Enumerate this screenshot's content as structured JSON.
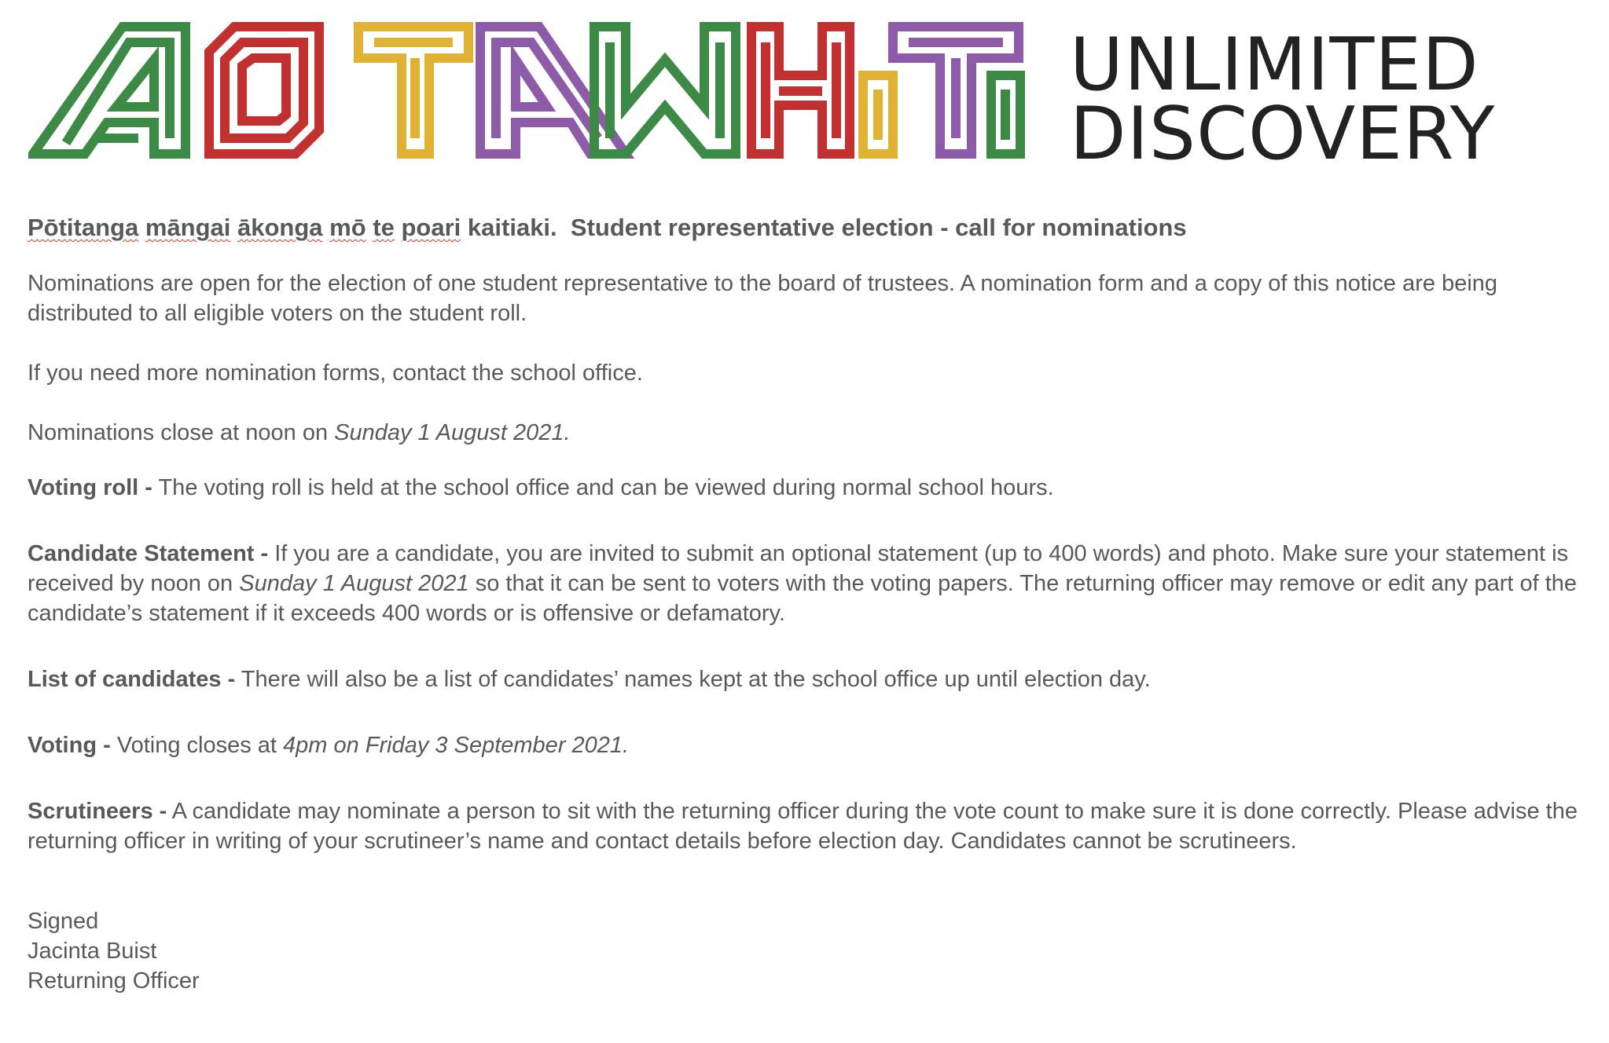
{
  "logo": {
    "mark_text": "AOTAWHITI",
    "line1": "UNLIMITED",
    "line2": "DISCOVERY",
    "colors": {
      "green": "#3d8a47",
      "red": "#c2312f",
      "yellow": "#e0b234",
      "purple": "#8e5ba8"
    }
  },
  "heading": {
    "maori_words": [
      "Pōtitanga",
      "māngai",
      "ākonga",
      "mō",
      "te",
      "poari"
    ],
    "maori_tail": "kaitiaki.",
    "english": "Student representative election - call for nominations"
  },
  "paragraphs": {
    "p1": "Nominations are open for the election of one student representative to the board of trustees.  A nomination form and a copy of this notice are being distributed to all eligible voters on the student roll.",
    "p2": "If you need more nomination forms, contact the school office.",
    "p3_text": "Nominations close at noon on ",
    "p3_date": "Sunday 1 August 2021."
  },
  "sections": {
    "voting_roll": {
      "label": "Voting roll -",
      "text": " The voting roll is held at the school office and can be viewed during normal school hours."
    },
    "candidate_statement": {
      "label": "Candidate Statement -",
      "text1": " If you are a candidate, you are invited to submit an optional statement (up to 400 words) and photo. Make sure your statement is received by noon on ",
      "date": "Sunday 1 August 2021",
      "text2": " so that it can be sent to voters with the voting papers.  The returning officer may remove or edit any part of the candidate’s statement if it exceeds 400 words or is offensive or defamatory."
    },
    "list_of_candidates": {
      "label": "List of candidates -",
      "text": " There will also be a list of candidates’ names kept at the school office up until election day."
    },
    "voting": {
      "label": "Voting -",
      "text": " Voting closes at ",
      "date": "4pm on Friday 3 September 2021."
    },
    "scrutineers": {
      "label": "Scrutineers -",
      "text": " A candidate may nominate a person to sit with the returning officer during the vote count to make sure it is done correctly. Please advise the returning officer in writing of your scrutineer’s name and contact details before election day. Candidates cannot be scrutineers."
    }
  },
  "signature": {
    "signed": "Signed",
    "name": "Jacinta Buist",
    "title": "Returning Officer"
  }
}
